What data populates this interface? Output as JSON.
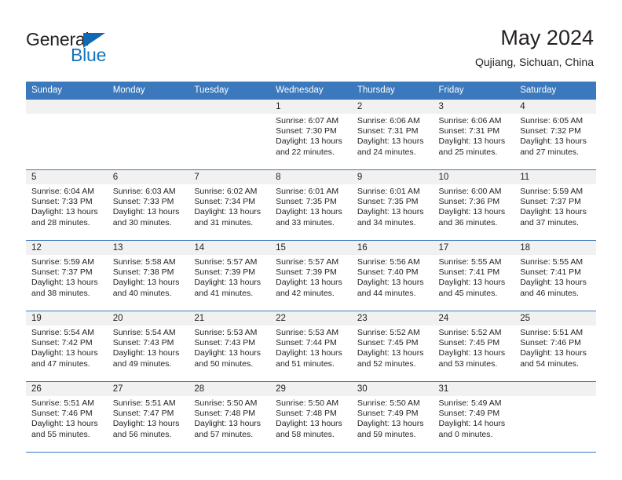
{
  "brand": {
    "name_top": "General",
    "name_bottom": "Blue",
    "triangle_color": "#0f69b4",
    "text_color": "#1574bb"
  },
  "header": {
    "title": "May 2024",
    "subtitle": "Qujiang, Sichuan, China"
  },
  "theme": {
    "header_bg": "#3b78bc",
    "daynum_bg": "#f1f1f1",
    "grid_line": "#3b78bc",
    "text": "#231f20"
  },
  "weekdays": [
    "Sunday",
    "Monday",
    "Tuesday",
    "Wednesday",
    "Thursday",
    "Friday",
    "Saturday"
  ],
  "weeks": [
    [
      {
        "day": ""
      },
      {
        "day": ""
      },
      {
        "day": ""
      },
      {
        "day": "1",
        "sunrise": "Sunrise: 6:07 AM",
        "sunset": "Sunset: 7:30 PM",
        "daylight": "Daylight: 13 hours and 22 minutes."
      },
      {
        "day": "2",
        "sunrise": "Sunrise: 6:06 AM",
        "sunset": "Sunset: 7:31 PM",
        "daylight": "Daylight: 13 hours and 24 minutes."
      },
      {
        "day": "3",
        "sunrise": "Sunrise: 6:06 AM",
        "sunset": "Sunset: 7:31 PM",
        "daylight": "Daylight: 13 hours and 25 minutes."
      },
      {
        "day": "4",
        "sunrise": "Sunrise: 6:05 AM",
        "sunset": "Sunset: 7:32 PM",
        "daylight": "Daylight: 13 hours and 27 minutes."
      }
    ],
    [
      {
        "day": "5",
        "sunrise": "Sunrise: 6:04 AM",
        "sunset": "Sunset: 7:33 PM",
        "daylight": "Daylight: 13 hours and 28 minutes."
      },
      {
        "day": "6",
        "sunrise": "Sunrise: 6:03 AM",
        "sunset": "Sunset: 7:33 PM",
        "daylight": "Daylight: 13 hours and 30 minutes."
      },
      {
        "day": "7",
        "sunrise": "Sunrise: 6:02 AM",
        "sunset": "Sunset: 7:34 PM",
        "daylight": "Daylight: 13 hours and 31 minutes."
      },
      {
        "day": "8",
        "sunrise": "Sunrise: 6:01 AM",
        "sunset": "Sunset: 7:35 PM",
        "daylight": "Daylight: 13 hours and 33 minutes."
      },
      {
        "day": "9",
        "sunrise": "Sunrise: 6:01 AM",
        "sunset": "Sunset: 7:35 PM",
        "daylight": "Daylight: 13 hours and 34 minutes."
      },
      {
        "day": "10",
        "sunrise": "Sunrise: 6:00 AM",
        "sunset": "Sunset: 7:36 PM",
        "daylight": "Daylight: 13 hours and 36 minutes."
      },
      {
        "day": "11",
        "sunrise": "Sunrise: 5:59 AM",
        "sunset": "Sunset: 7:37 PM",
        "daylight": "Daylight: 13 hours and 37 minutes."
      }
    ],
    [
      {
        "day": "12",
        "sunrise": "Sunrise: 5:59 AM",
        "sunset": "Sunset: 7:37 PM",
        "daylight": "Daylight: 13 hours and 38 minutes."
      },
      {
        "day": "13",
        "sunrise": "Sunrise: 5:58 AM",
        "sunset": "Sunset: 7:38 PM",
        "daylight": "Daylight: 13 hours and 40 minutes."
      },
      {
        "day": "14",
        "sunrise": "Sunrise: 5:57 AM",
        "sunset": "Sunset: 7:39 PM",
        "daylight": "Daylight: 13 hours and 41 minutes."
      },
      {
        "day": "15",
        "sunrise": "Sunrise: 5:57 AM",
        "sunset": "Sunset: 7:39 PM",
        "daylight": "Daylight: 13 hours and 42 minutes."
      },
      {
        "day": "16",
        "sunrise": "Sunrise: 5:56 AM",
        "sunset": "Sunset: 7:40 PM",
        "daylight": "Daylight: 13 hours and 44 minutes."
      },
      {
        "day": "17",
        "sunrise": "Sunrise: 5:55 AM",
        "sunset": "Sunset: 7:41 PM",
        "daylight": "Daylight: 13 hours and 45 minutes."
      },
      {
        "day": "18",
        "sunrise": "Sunrise: 5:55 AM",
        "sunset": "Sunset: 7:41 PM",
        "daylight": "Daylight: 13 hours and 46 minutes."
      }
    ],
    [
      {
        "day": "19",
        "sunrise": "Sunrise: 5:54 AM",
        "sunset": "Sunset: 7:42 PM",
        "daylight": "Daylight: 13 hours and 47 minutes."
      },
      {
        "day": "20",
        "sunrise": "Sunrise: 5:54 AM",
        "sunset": "Sunset: 7:43 PM",
        "daylight": "Daylight: 13 hours and 49 minutes."
      },
      {
        "day": "21",
        "sunrise": "Sunrise: 5:53 AM",
        "sunset": "Sunset: 7:43 PM",
        "daylight": "Daylight: 13 hours and 50 minutes."
      },
      {
        "day": "22",
        "sunrise": "Sunrise: 5:53 AM",
        "sunset": "Sunset: 7:44 PM",
        "daylight": "Daylight: 13 hours and 51 minutes."
      },
      {
        "day": "23",
        "sunrise": "Sunrise: 5:52 AM",
        "sunset": "Sunset: 7:45 PM",
        "daylight": "Daylight: 13 hours and 52 minutes."
      },
      {
        "day": "24",
        "sunrise": "Sunrise: 5:52 AM",
        "sunset": "Sunset: 7:45 PM",
        "daylight": "Daylight: 13 hours and 53 minutes."
      },
      {
        "day": "25",
        "sunrise": "Sunrise: 5:51 AM",
        "sunset": "Sunset: 7:46 PM",
        "daylight": "Daylight: 13 hours and 54 minutes."
      }
    ],
    [
      {
        "day": "26",
        "sunrise": "Sunrise: 5:51 AM",
        "sunset": "Sunset: 7:46 PM",
        "daylight": "Daylight: 13 hours and 55 minutes."
      },
      {
        "day": "27",
        "sunrise": "Sunrise: 5:51 AM",
        "sunset": "Sunset: 7:47 PM",
        "daylight": "Daylight: 13 hours and 56 minutes."
      },
      {
        "day": "28",
        "sunrise": "Sunrise: 5:50 AM",
        "sunset": "Sunset: 7:48 PM",
        "daylight": "Daylight: 13 hours and 57 minutes."
      },
      {
        "day": "29",
        "sunrise": "Sunrise: 5:50 AM",
        "sunset": "Sunset: 7:48 PM",
        "daylight": "Daylight: 13 hours and 58 minutes."
      },
      {
        "day": "30",
        "sunrise": "Sunrise: 5:50 AM",
        "sunset": "Sunset: 7:49 PM",
        "daylight": "Daylight: 13 hours and 59 minutes."
      },
      {
        "day": "31",
        "sunrise": "Sunrise: 5:49 AM",
        "sunset": "Sunset: 7:49 PM",
        "daylight": "Daylight: 14 hours and 0 minutes."
      },
      {
        "day": ""
      }
    ]
  ]
}
